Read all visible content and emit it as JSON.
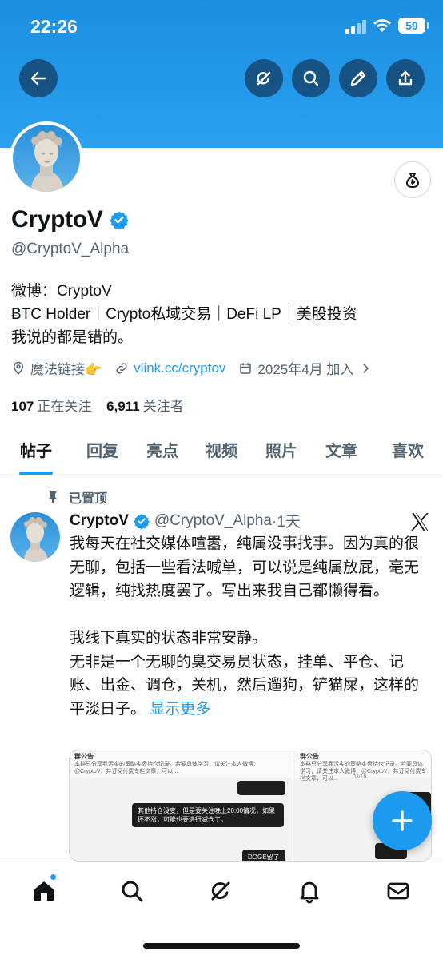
{
  "status_bar": {
    "time": "22:26",
    "battery": "59"
  },
  "header": {
    "back_icon": "arrow-left-icon",
    "actions": [
      "grok-icon",
      "search-icon",
      "pencil-icon",
      "share-icon"
    ]
  },
  "profile": {
    "name": "CryptoV",
    "handle": "@CryptoV_Alpha",
    "bio_lines": [
      "微博：CryptoV",
      "ɃTC Holder｜Crypto私域交易｜DeFi LP｜美股投资",
      "我说的都是错的。"
    ],
    "location": "魔法链接👉",
    "website": "vlink.cc/cryptov",
    "joined": "2025年4月 加入",
    "following_count": "107",
    "following_label": "正在关注",
    "followers_count": "6,911",
    "followers_label": "关注者"
  },
  "tabs": [
    "帖子",
    "回复",
    "亮点",
    "视频",
    "照片",
    "文章",
    "喜欢"
  ],
  "active_tab": 0,
  "pinned_post": {
    "pinned_label": "已置顶",
    "name": "CryptoV",
    "handle": "@CryptoV_Alpha",
    "time": "·1天",
    "paragraph1": "我每天在社交媒体喧嚣，纯属没事找事。因为真的很无聊，包括一些看法喊单，可以说是纯属放屁，毫无逻辑，纯找热度罢了。写出来我自己都懒得看。",
    "paragraph2": "我线下真实的状态非常安静。",
    "paragraph3": "无非是一个无聊的臭交易员状态，挂单、平仓、记账、出金、调仓，关机，然后遛狗，铲猫屎，这样的平淡日子。",
    "show_more": "显示更多",
    "media": {
      "notice_title": "群公告",
      "notice_text": "本群只分享我污实的策略实盘持仓记录。若要具体学习，请关注本人微博：@CryptoV，并订阅付费专栏文章，可以...",
      "bubble1": "其他持仓没变，但是要关注晚上20:00情况，如果还不涨，可能也要进行减仓了。",
      "bubble2": "DOGE留了",
      "right_notice_title": "群公告",
      "right_notice_text": "本群只分享我污实的策略实盘持仓记录。若要具体学习，请关注本人微博：@CryptoV，并订阅付费专栏文章，可以...",
      "right_time": "03/18"
    }
  },
  "bottom_nav": [
    "home-icon",
    "search-icon",
    "grok-icon",
    "bell-icon",
    "mail-icon"
  ]
}
